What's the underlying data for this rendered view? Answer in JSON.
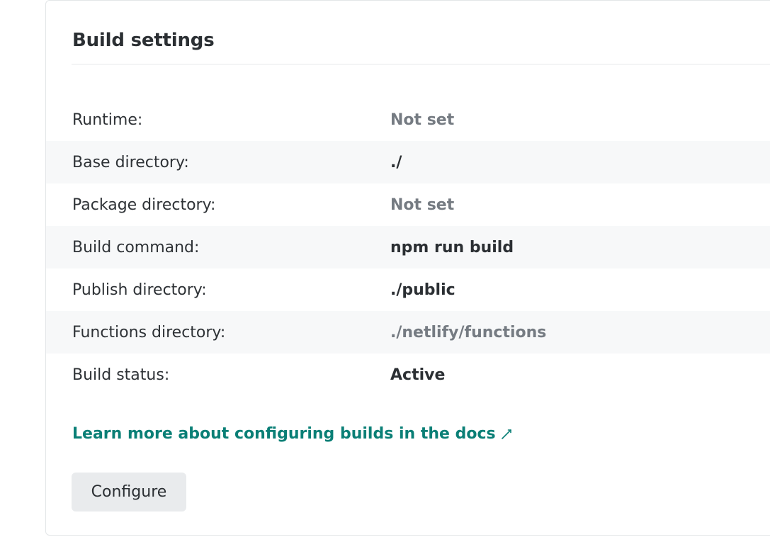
{
  "card": {
    "title": "Build settings"
  },
  "settings": [
    {
      "label": "Runtime:",
      "value": "Not set",
      "muted": true
    },
    {
      "label": "Base directory:",
      "value": "./",
      "muted": false
    },
    {
      "label": "Package directory:",
      "value": "Not set",
      "muted": true
    },
    {
      "label": "Build command:",
      "value": "npm run build",
      "muted": false
    },
    {
      "label": "Publish directory:",
      "value": "./public",
      "muted": false
    },
    {
      "label": "Functions directory:",
      "value": "./netlify/functions",
      "muted": true
    },
    {
      "label": "Build status:",
      "value": "Active",
      "muted": false
    }
  ],
  "docs_link": {
    "label": "Learn more about configuring builds in the docs",
    "icon": "external-link-icon"
  },
  "configure_button": {
    "label": "Configure"
  },
  "colors": {
    "link": "#0a7f76",
    "muted_value": "#757b82",
    "text": "#2b2f33",
    "shaded_row": "#f7f8f9",
    "button_bg": "#e9ebed"
  }
}
